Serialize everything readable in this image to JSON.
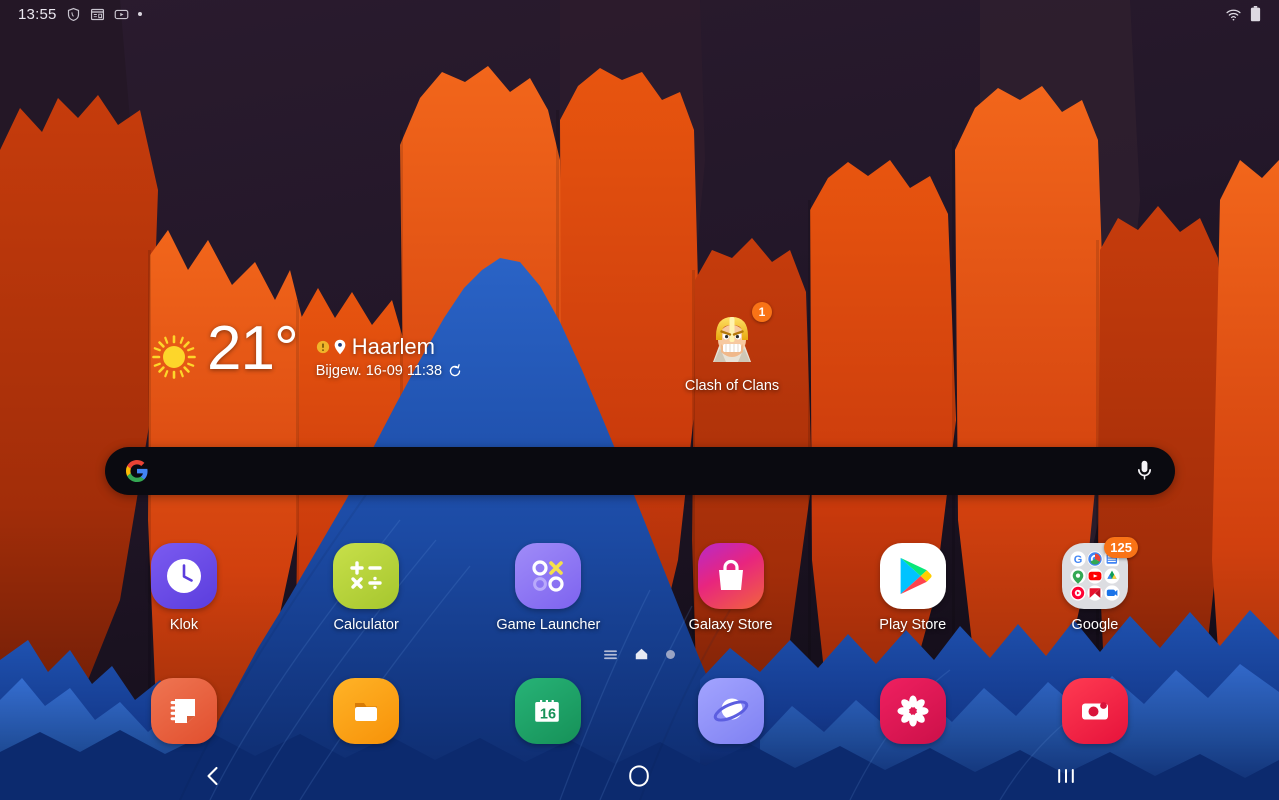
{
  "status_bar": {
    "clock": "13:55",
    "left_icons": [
      {
        "name": "shield-icon",
        "label": "Security shield"
      },
      {
        "name": "screenshot-icon",
        "label": "Screenshot"
      },
      {
        "name": "youtube-icon",
        "label": "YouTube"
      },
      {
        "name": "more-notifications-dot-icon",
        "label": "More notifications"
      }
    ],
    "right_icons": [
      {
        "name": "wifi-icon",
        "label": "Wi-Fi connected"
      },
      {
        "name": "battery-icon",
        "label": "Battery"
      }
    ]
  },
  "weather": {
    "temperature": "21",
    "degree_symbol": "°",
    "city": "Haarlem",
    "updated": "Bijgew. 16-09 11:38",
    "condition_icon": "sun-icon",
    "alert_icon": "weather-alert-icon",
    "location_icon": "location-pin-icon",
    "refresh_icon": "refresh-icon"
  },
  "desktop_apps": [
    {
      "id": "clash-of-clans",
      "label": "Clash of Clans",
      "badge": "1",
      "icon": "clash-of-clans-icon"
    }
  ],
  "search": {
    "logo_icon": "google-g-icon",
    "mic_icon": "microphone-icon",
    "placeholder": "",
    "value": "",
    "background": "#0a0a10"
  },
  "app_grid": [
    {
      "id": "klok",
      "label": "Klok",
      "icon": "clock-icon",
      "color": "#6b4ee6"
    },
    {
      "id": "calculator",
      "label": "Calculator",
      "icon": "calculator-icon",
      "color": "#b9d640"
    },
    {
      "id": "game-launcher",
      "label": "Game Launcher",
      "icon": "game-launcher-icon",
      "color": "#8b6ff0"
    },
    {
      "id": "galaxy-store",
      "label": "Galaxy Store",
      "icon": "galaxy-store-icon",
      "color": "#e8267e"
    },
    {
      "id": "play-store",
      "label": "Play Store",
      "icon": "play-store-icon",
      "color": "#ffffff"
    },
    {
      "id": "google-folder",
      "label": "Google",
      "icon": "google-folder-icon",
      "color": "#d9dade",
      "badge": "125",
      "folder_apps": [
        "Google",
        "Chrome",
        "Google News",
        "Maps",
        "YouTube",
        "Drive",
        "YT Music",
        "Play Movies",
        "Meet"
      ]
    }
  ],
  "page_indicator": {
    "items": [
      {
        "name": "app-list-page-indicator",
        "type": "lines",
        "active": false
      },
      {
        "name": "home-page-indicator",
        "type": "home",
        "active": true
      },
      {
        "name": "page-indicator-dot",
        "type": "dot",
        "active": false
      }
    ]
  },
  "dock": [
    {
      "id": "samsung-notes",
      "label": "Samsung Notes",
      "icon": "notes-icon",
      "color": "#e9613f"
    },
    {
      "id": "my-files",
      "label": "My Files",
      "icon": "folder-icon",
      "color": "#fca311"
    },
    {
      "id": "calendar",
      "label": "Calendar",
      "icon": "calendar-icon",
      "color": "#1a9e62",
      "day": "16"
    },
    {
      "id": "internet",
      "label": "Internet",
      "icon": "samsung-internet-icon",
      "color": "#8b8cf5"
    },
    {
      "id": "gallery",
      "label": "Gallery",
      "icon": "gallery-flower-icon",
      "color": "#e01a52"
    },
    {
      "id": "camera",
      "label": "Camera",
      "icon": "camera-icon",
      "color": "#f02040"
    }
  ],
  "nav_bar": {
    "back": {
      "name": "back-button",
      "icon": "chevron-left-icon"
    },
    "home": {
      "name": "home-button",
      "icon": "circle-icon"
    },
    "recents": {
      "name": "recents-button",
      "icon": "three-bars-icon"
    }
  },
  "colors": {
    "wallpaper_dark": "#1d1422",
    "wallpaper_orange": "#d4410f",
    "wallpaper_orange_light": "#e8641c",
    "wallpaper_blue": "#1d4ea8",
    "wallpaper_blue_dark": "#10306e",
    "badge_orange": "#f97316",
    "text_primary": "#ffffff"
  }
}
